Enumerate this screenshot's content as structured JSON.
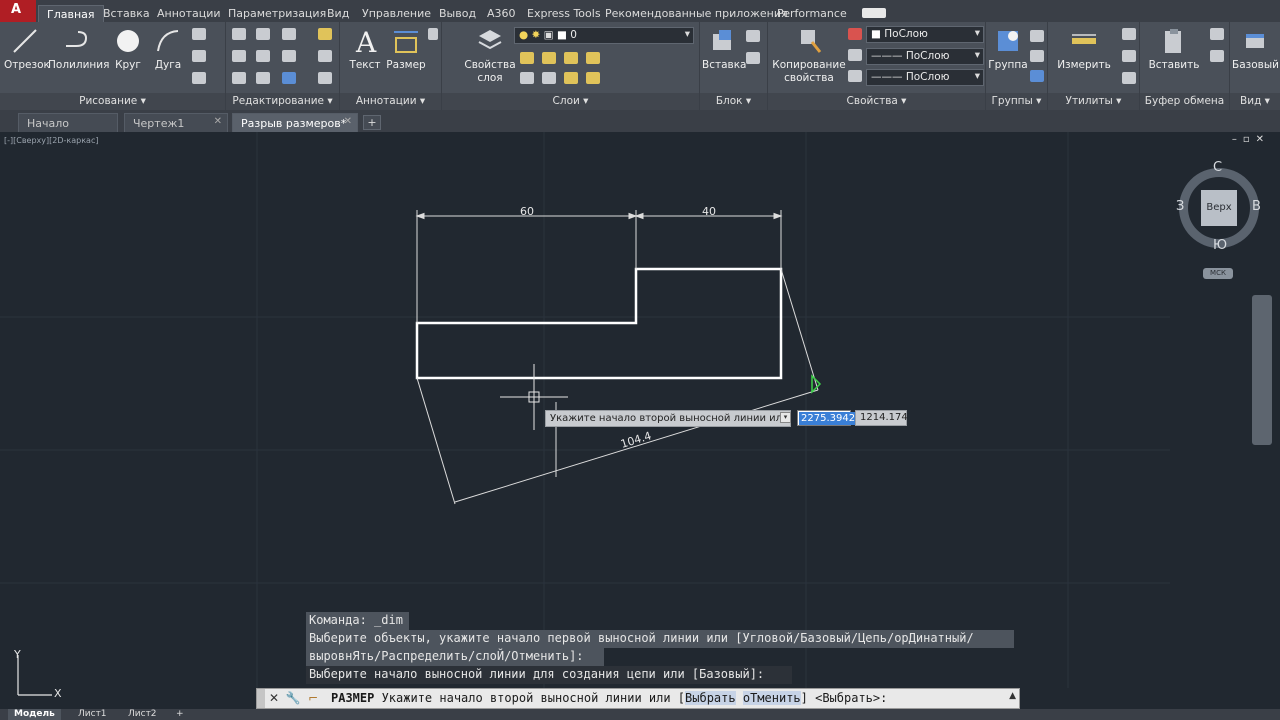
{
  "ribbon_tabs": [
    "Главная",
    "Вставка",
    "Аннотации",
    "Параметризация",
    "Вид",
    "Управление",
    "Вывод",
    "A360",
    "Express Tools",
    "Рекомендованные приложения",
    "Performance"
  ],
  "ribbon_groups": {
    "draw": {
      "title": "Рисование ▾",
      "line": "Отрезок",
      "polyline": "Полилиния",
      "circle": "Круг",
      "arc": "Дуга"
    },
    "modify": {
      "title": "Редактирование ▾"
    },
    "annotation": {
      "title": "Аннотации ▾",
      "text": "Текст",
      "dimension": "Размер"
    },
    "layers": {
      "title": "Слои ▾",
      "layer_props_line1": "Свойства",
      "layer_props_line2": "слоя",
      "current_layer": "0"
    },
    "block": {
      "title": "Блок ▾",
      "insert": "Вставка"
    },
    "properties": {
      "title": "Свойства ▾",
      "copy_line1": "Копирование",
      "copy_line2": "свойства",
      "color": "ПоСлою",
      "linetype": "ПоСлою",
      "lineweight": "ПоСлою"
    },
    "groups": {
      "title": "Группы ▾",
      "group": "Группа"
    },
    "utilities": {
      "title": "Утилиты ▾",
      "measure": "Измерить"
    },
    "clipboard": {
      "title": "Буфер обмена",
      "paste": "Вставить"
    },
    "view": {
      "title": "Вид ▾",
      "base": "Базовый"
    }
  },
  "doc_tabs": [
    {
      "label": "Начало"
    },
    {
      "label": "Чертеж1"
    },
    {
      "label": "Разрыв размеров*"
    }
  ],
  "viewcube": {
    "north": "С",
    "south": "Ю",
    "west": "З",
    "east": "В",
    "face": "Верх",
    "wcs": "МСК"
  },
  "drawing": {
    "dim_top_left": "60",
    "dim_top_right": "40",
    "dim_aligned": "104.4"
  },
  "dynamic_input": {
    "prompt": "Укажите начало второй выносной линии или",
    "x_value": "2275.3942",
    "y_value": "1214.174"
  },
  "command_history": [
    "Команда:  _dim",
    "Выберите объекты, укажите начало первой выносной линии или [Угловой/Базовый/Цепь/орДинатный/",
    "выровнЯть/Распределить/слоЙ/Отменить]:",
    "Выберите начало выносной линии для создания цепи или [Базовый]:"
  ],
  "command_line": {
    "command": "РАЗМЕР",
    "prompt": " Укажите начало второй выносной линии или [",
    "opt1": "Выбрать",
    "opt2": "оТменить",
    "tail": "] <Выбрать>:"
  },
  "status_tabs": [
    "Модель",
    "Лист1",
    "Лист2"
  ],
  "ucs": {
    "x": "X",
    "y": "Y"
  }
}
